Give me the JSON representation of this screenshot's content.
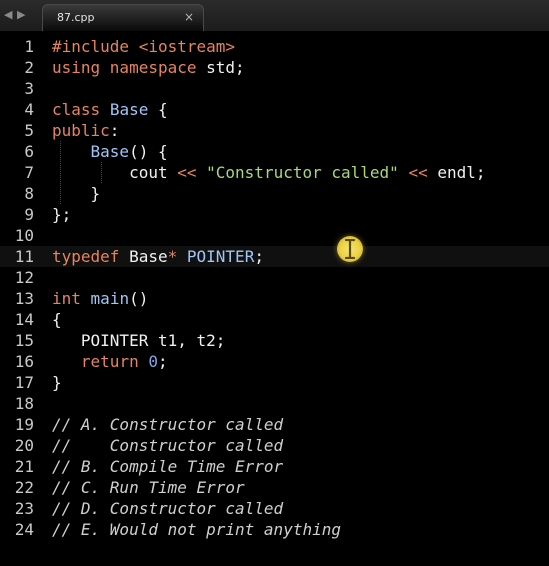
{
  "tabbar": {
    "back_icon": "◀",
    "forward_icon": "▶",
    "tab_title": "87.cpp",
    "close_icon": "×"
  },
  "editor": {
    "current_line": 11,
    "lines": [
      {
        "n": "1",
        "tokens": [
          {
            "c": "tok-pre",
            "t": "#include <iostream>"
          }
        ]
      },
      {
        "n": "2",
        "tokens": [
          {
            "c": "tok-kw",
            "t": "using namespace"
          },
          {
            "c": "tok-plain",
            "t": " std;"
          }
        ]
      },
      {
        "n": "3",
        "tokens": []
      },
      {
        "n": "4",
        "tokens": [
          {
            "c": "tok-kw",
            "t": "class"
          },
          {
            "c": "tok-plain",
            "t": " "
          },
          {
            "c": "tok-type",
            "t": "Base"
          },
          {
            "c": "tok-plain",
            "t": " {"
          }
        ]
      },
      {
        "n": "5",
        "tokens": [
          {
            "c": "tok-kw",
            "t": "public"
          },
          {
            "c": "tok-plain",
            "t": ":"
          }
        ]
      },
      {
        "n": "6",
        "tokens": [
          {
            "c": "tok-plain",
            "t": "    "
          },
          {
            "c": "tok-fn",
            "t": "Base"
          },
          {
            "c": "tok-plain",
            "t": "() {"
          }
        ]
      },
      {
        "n": "7",
        "tokens": [
          {
            "c": "tok-plain",
            "t": "        cout "
          },
          {
            "c": "tok-op",
            "t": "<<"
          },
          {
            "c": "tok-plain",
            "t": " "
          },
          {
            "c": "tok-str",
            "t": "\"Constructor called\""
          },
          {
            "c": "tok-plain",
            "t": " "
          },
          {
            "c": "tok-op",
            "t": "<<"
          },
          {
            "c": "tok-plain",
            "t": " endl;"
          }
        ]
      },
      {
        "n": "8",
        "tokens": [
          {
            "c": "tok-plain",
            "t": "    }"
          }
        ]
      },
      {
        "n": "9",
        "tokens": [
          {
            "c": "tok-plain",
            "t": "};"
          }
        ]
      },
      {
        "n": "10",
        "tokens": []
      },
      {
        "n": "11",
        "tokens": [
          {
            "c": "tok-kw",
            "t": "typedef"
          },
          {
            "c": "tok-plain",
            "t": " Base"
          },
          {
            "c": "tok-op",
            "t": "*"
          },
          {
            "c": "tok-plain",
            "t": " "
          },
          {
            "c": "tok-type",
            "t": "POINTER"
          },
          {
            "c": "tok-plain",
            "t": ";"
          }
        ]
      },
      {
        "n": "12",
        "tokens": []
      },
      {
        "n": "13",
        "tokens": [
          {
            "c": "tok-kw",
            "t": "int"
          },
          {
            "c": "tok-plain",
            "t": " "
          },
          {
            "c": "tok-fn",
            "t": "main"
          },
          {
            "c": "tok-plain",
            "t": "()"
          }
        ]
      },
      {
        "n": "14",
        "tokens": [
          {
            "c": "tok-plain",
            "t": "{"
          }
        ]
      },
      {
        "n": "15",
        "tokens": [
          {
            "c": "tok-plain",
            "t": "   POINTER t1, t2;"
          }
        ]
      },
      {
        "n": "16",
        "tokens": [
          {
            "c": "tok-plain",
            "t": "   "
          },
          {
            "c": "tok-kw",
            "t": "return"
          },
          {
            "c": "tok-plain",
            "t": " "
          },
          {
            "c": "tok-num",
            "t": "0"
          },
          {
            "c": "tok-plain",
            "t": ";"
          }
        ]
      },
      {
        "n": "17",
        "tokens": [
          {
            "c": "tok-plain",
            "t": "}"
          }
        ]
      },
      {
        "n": "18",
        "tokens": []
      },
      {
        "n": "19",
        "tokens": [
          {
            "c": "tok-comment",
            "t": "// A. Constructor called"
          }
        ]
      },
      {
        "n": "20",
        "tokens": [
          {
            "c": "tok-comment",
            "t": "//    Constructor called"
          }
        ]
      },
      {
        "n": "21",
        "tokens": [
          {
            "c": "tok-comment",
            "t": "// B. Compile Time Error"
          }
        ]
      },
      {
        "n": "22",
        "tokens": [
          {
            "c": "tok-comment",
            "t": "// C. Run Time Error"
          }
        ]
      },
      {
        "n": "23",
        "tokens": [
          {
            "c": "tok-comment",
            "t": "// D. Constructor called"
          }
        ]
      },
      {
        "n": "24",
        "tokens": [
          {
            "c": "tok-comment",
            "t": "// E. Would not print anything"
          }
        ]
      }
    ]
  },
  "mouse": {
    "cursor_icon": "text-cursor-icon"
  }
}
